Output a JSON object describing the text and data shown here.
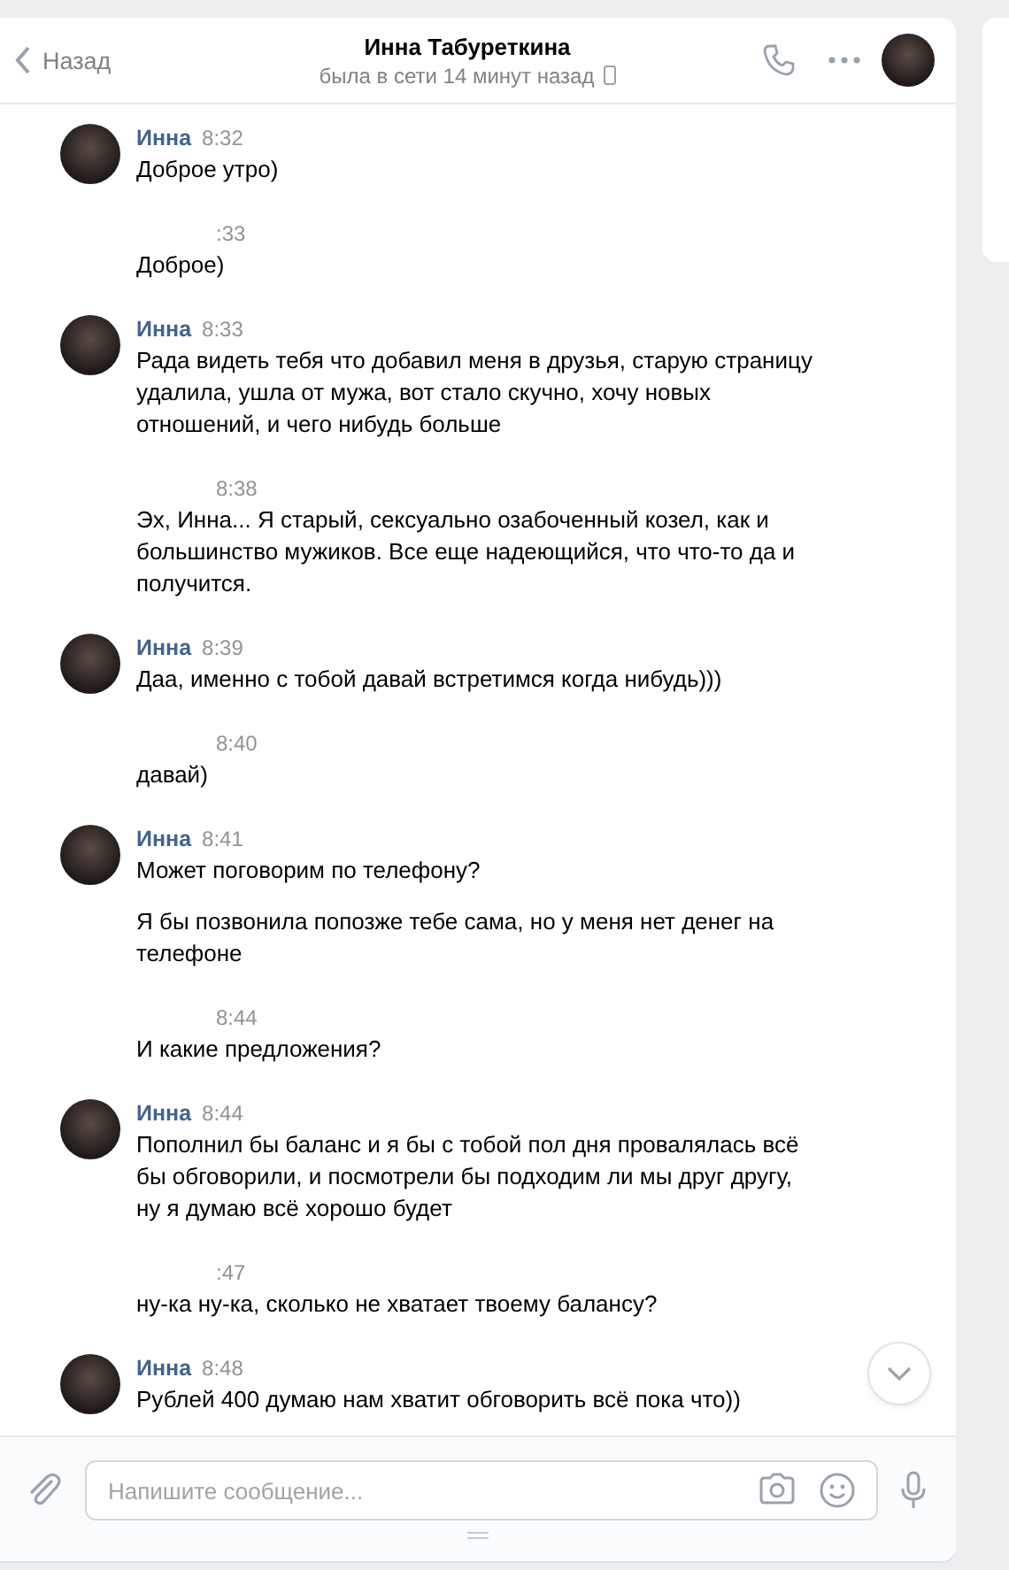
{
  "header": {
    "back": "Назад",
    "title": "Инна Табуреткина",
    "status": "была в сети 14 минут назад"
  },
  "messages": [
    {
      "kind": "incoming",
      "author": "Инна",
      "time": "8:32",
      "paragraphs": [
        "Доброе утро)"
      ]
    },
    {
      "kind": "outgoing",
      "time": ":33",
      "paragraphs": [
        "Доброе)"
      ]
    },
    {
      "kind": "incoming",
      "author": "Инна",
      "time": "8:33",
      "paragraphs": [
        "Рада видеть тебя что добавил меня в друзья, старую страницу удалила, ушла от мужа, вот стало скучно, хочу новых отношений, и чего нибудь больше"
      ]
    },
    {
      "kind": "outgoing",
      "time": "8:38",
      "paragraphs": [
        "Эх, Инна... Я старый, сексуально озабоченный козел, как и большинство мужиков. Все еще надеющийся, что что-то да и получится."
      ]
    },
    {
      "kind": "incoming",
      "author": "Инна",
      "time": "8:39",
      "paragraphs": [
        "Даа, именно с тобой давай встретимся когда нибудь)))"
      ]
    },
    {
      "kind": "outgoing",
      "time": "8:40",
      "paragraphs": [
        "давай)"
      ]
    },
    {
      "kind": "incoming",
      "author": "Инна",
      "time": "8:41",
      "paragraphs": [
        "Может поговорим по телефону?",
        "Я бы позвонила попозже тебе сама, но у меня нет денег на телефоне"
      ]
    },
    {
      "kind": "outgoing",
      "time": "8:44",
      "paragraphs": [
        "И какие предложения?"
      ]
    },
    {
      "kind": "incoming",
      "author": "Инна",
      "time": "8:44",
      "paragraphs": [
        "Пополнил бы баланс и я бы с тобой пол дня провалялась всё бы обговорили, и посмотрели бы подходим ли мы друг другу, ну я думаю всё хорошо будет"
      ]
    },
    {
      "kind": "outgoing",
      "time": ":47",
      "paragraphs": [
        "ну-ка ну-ка, сколько не хватает твоему балансу?"
      ]
    },
    {
      "kind": "incoming",
      "author": "Инна",
      "time": "8:48",
      "paragraphs": [
        "Рублей 400 думаю нам хватит обговорить всё пока что))"
      ]
    }
  ],
  "composer": {
    "placeholder": "Напишите сообщение..."
  }
}
